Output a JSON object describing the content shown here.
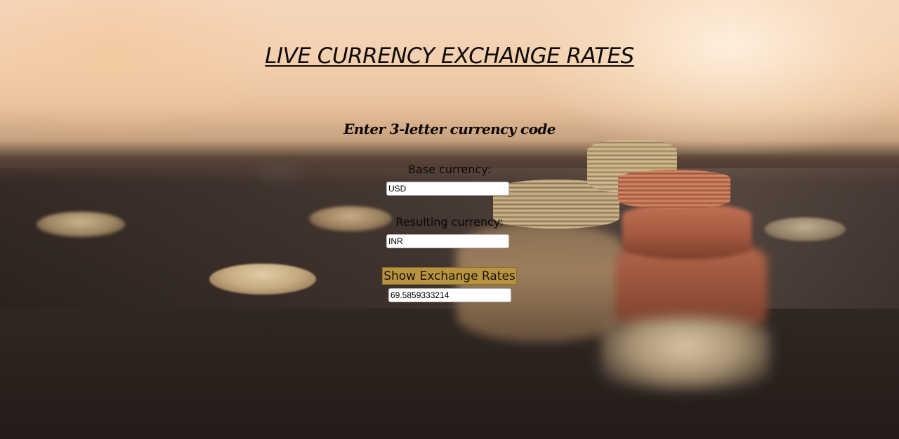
{
  "page": {
    "title": "LIVE CURRENCY EXCHANGE RATES",
    "subtitle": "Enter 3-letter currency code"
  },
  "form": {
    "base_label": "Base currency:",
    "base_value": "USD",
    "result_label": "Resulting currency:",
    "result_value": "INR",
    "button_label": "Show Exchange Rates",
    "output_value": "69.5859333214"
  },
  "colors": {
    "button_background": "#b89440",
    "title_text": "#0d0906"
  }
}
